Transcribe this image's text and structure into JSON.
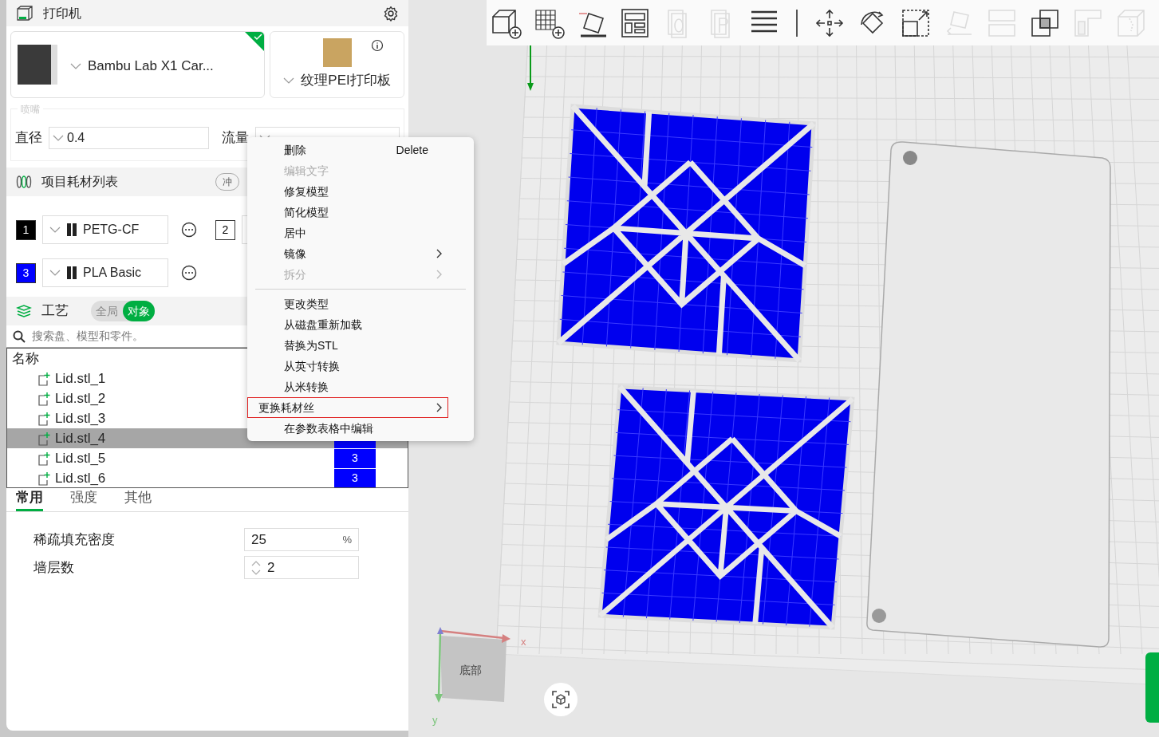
{
  "printer": {
    "title": "打印机",
    "model": "Bambu Lab X1 Car...",
    "selected": true,
    "plate": "纹理PEI打印板"
  },
  "nozzle": {
    "legend": "喷嘴",
    "diameter_label": "直径",
    "diameter": "0.4",
    "flow_label": "流量"
  },
  "filaments": {
    "title": "项目耗材列表",
    "button": "冲",
    "items": [
      {
        "index": "1",
        "color": "#000000",
        "name": "PETG-CF"
      },
      {
        "index": "2",
        "color": "#ffffff"
      },
      {
        "index": "3",
        "color": "#0000ff",
        "name": "PLA Basic"
      }
    ]
  },
  "process": {
    "title": "工艺",
    "scope": [
      {
        "label": "全局",
        "selected": false
      },
      {
        "label": "对象",
        "selected": true
      }
    ],
    "search_placeholder": "搜索盘、模型和零件。",
    "column": "名称",
    "rows": [
      {
        "name": "Lid.stl_1",
        "selected": false
      },
      {
        "name": "Lid.stl_2",
        "selected": false
      },
      {
        "name": "Lid.stl_3",
        "selected": false
      },
      {
        "name": "Lid.stl_4",
        "selected": true,
        "color": "#0000ff"
      },
      {
        "name": "Lid.stl_5",
        "selected": false,
        "filament": "3",
        "color": "#0000ff"
      },
      {
        "name": "Lid.stl_6",
        "selected": false,
        "filament": "3",
        "color": "#0000ff"
      }
    ]
  },
  "tabs": [
    {
      "label": "常用",
      "selected": true
    },
    {
      "label": "强度",
      "selected": false
    },
    {
      "label": "其他",
      "selected": false
    }
  ],
  "settings": [
    {
      "kind": "percent",
      "label": "稀疏填充密度",
      "value": "25",
      "unit": "%"
    },
    {
      "kind": "spin",
      "label": "墙层数",
      "value": "2"
    }
  ],
  "toolbar": [
    {
      "kind": "add-cube",
      "disabled": false
    },
    {
      "kind": "add-plate",
      "disabled": false
    },
    {
      "kind": "auto-orient",
      "disabled": false
    },
    {
      "kind": "arrange",
      "disabled": false
    },
    {
      "kind": "plate-o",
      "disabled": true
    },
    {
      "kind": "plate-p",
      "disabled": true
    },
    {
      "kind": "layers",
      "disabled": false
    },
    {
      "kind": "separator"
    },
    {
      "kind": "move",
      "disabled": false
    },
    {
      "kind": "rotate",
      "disabled": false
    },
    {
      "kind": "scale",
      "disabled": false
    },
    {
      "kind": "lay-face",
      "disabled": true
    },
    {
      "kind": "split",
      "disabled": true
    },
    {
      "kind": "boolean",
      "disabled": false
    },
    {
      "kind": "cut",
      "disabled": true
    },
    {
      "kind": "seam",
      "disabled": true
    }
  ],
  "menu": {
    "items": [
      {
        "kind": "item",
        "label": "删除",
        "shortcut": "Delete",
        "disabled": false,
        "submenu": false,
        "highlighted": false
      },
      {
        "kind": "item",
        "label": "编辑文字",
        "disabled": true,
        "submenu": false,
        "highlighted": false
      },
      {
        "kind": "item",
        "label": "修复模型",
        "disabled": false,
        "submenu": false,
        "highlighted": false
      },
      {
        "kind": "item",
        "label": "简化模型",
        "disabled": false,
        "submenu": false,
        "highlighted": false
      },
      {
        "kind": "item",
        "label": "居中",
        "disabled": false,
        "submenu": false,
        "highlighted": false
      },
      {
        "kind": "item",
        "label": "镜像",
        "disabled": false,
        "submenu": true,
        "highlighted": false
      },
      {
        "kind": "item",
        "label": "拆分",
        "disabled": true,
        "submenu": true,
        "highlighted": false
      },
      {
        "kind": "separator"
      },
      {
        "kind": "item",
        "label": "更改类型",
        "disabled": false,
        "submenu": false,
        "highlighted": false
      },
      {
        "kind": "item",
        "label": "从磁盘重新加载",
        "disabled": false,
        "submenu": false,
        "highlighted": false
      },
      {
        "kind": "item",
        "label": "替换为STL",
        "disabled": false,
        "submenu": false,
        "highlighted": false
      },
      {
        "kind": "item",
        "label": "从英寸转换",
        "disabled": false,
        "submenu": false,
        "highlighted": false
      },
      {
        "kind": "item",
        "label": "从米转换",
        "disabled": false,
        "submenu": false,
        "highlighted": false
      },
      {
        "kind": "item",
        "label": "更换耗材丝",
        "disabled": false,
        "submenu": true,
        "highlighted": true
      },
      {
        "kind": "item",
        "label": "在参数表格中编辑",
        "disabled": false,
        "submenu": false,
        "highlighted": false
      }
    ]
  },
  "viewport": {
    "view_label": "底部",
    "x_axis": "x",
    "y_axis": "y"
  }
}
